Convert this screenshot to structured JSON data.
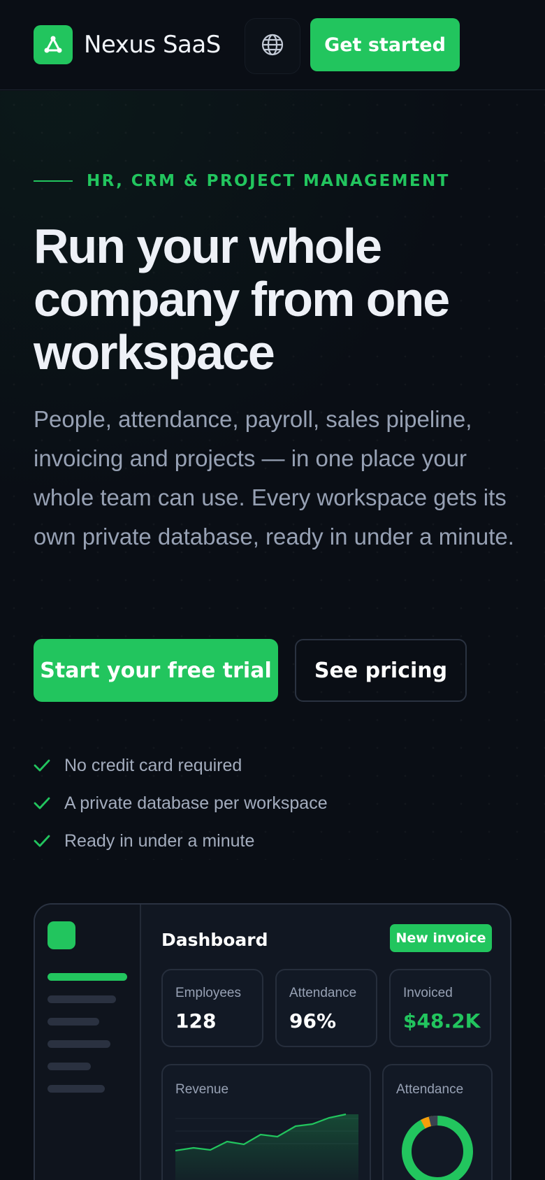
{
  "header": {
    "brand": "Nexus SaaS",
    "cta_label": "Get started"
  },
  "hero": {
    "eyebrow": "HR, CRM & PROJECT MANAGEMENT",
    "headline_lines": [
      "Run your whole",
      "company from one",
      "workspace"
    ],
    "subtext": "People, attendance, payroll, sales pipeline, invoicing and projects — in one place your whole team can use. Every workspace gets its own private database, ready in under a minute.",
    "primary_cta": "Start your free trial",
    "secondary_cta": "See pricing",
    "checks": [
      "No credit card required",
      "A private database per workspace",
      "Ready in under a minute"
    ]
  },
  "dashboard": {
    "title": "Dashboard",
    "action_label": "New invoice",
    "stats": [
      {
        "label": "Employees",
        "value": "128"
      },
      {
        "label": "Attendance",
        "value": "96%"
      },
      {
        "label": "Invoiced",
        "value": "$48.2K"
      }
    ],
    "revenue_label": "Revenue",
    "attendance_label": "Attendance"
  },
  "colors": {
    "accent": "#22c55e",
    "background": "#0a0e15",
    "warning": "#f59e0b"
  }
}
